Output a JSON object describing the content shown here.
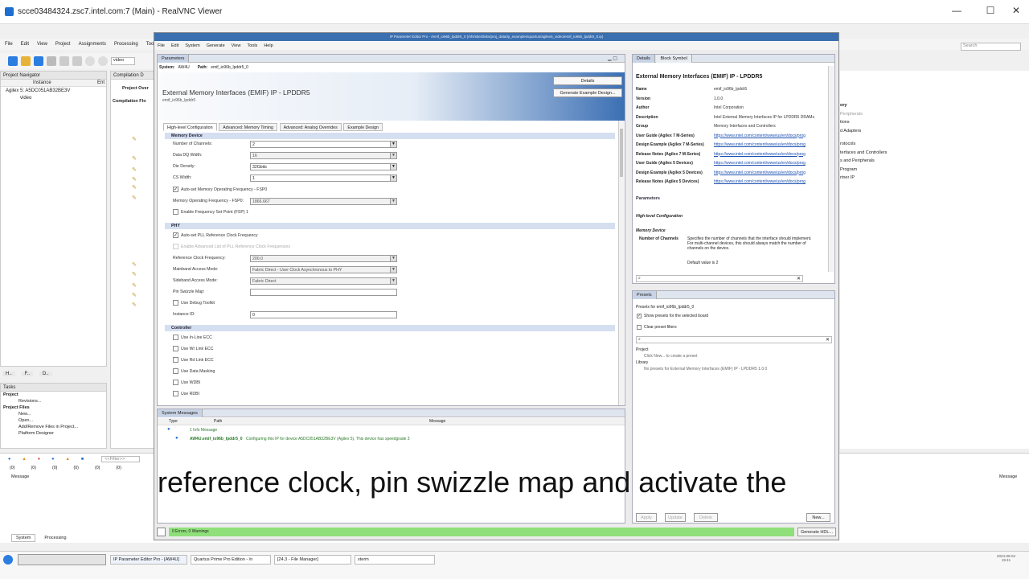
{
  "vnc": {
    "title": "scce03484324.zsc7.intel.com:7 (Main) - RealVNC Viewer",
    "min": "—",
    "max": "☐",
    "close": "✕"
  },
  "quartus": {
    "menu": [
      "File",
      "Edit",
      "View",
      "Project",
      "Assignments",
      "Processing",
      "Tool"
    ],
    "search_placeholder": "Search",
    "toolbar_field": "video",
    "project_navigator": "Project Navigator",
    "instance_header": "Instance",
    "entity_header": "Ent",
    "device_item": "Agilex 5: A5DC051AB32BE3V",
    "video_item": "video",
    "compilation_tab": "Compilation D",
    "project_over": "Project Over",
    "compilation_flow": "Compilation Flo",
    "nav_tabs": [
      "H..",
      "F..",
      "D.."
    ],
    "tasks_title": "Tasks",
    "tasks": [
      {
        "label": "Project",
        "bold": true
      },
      {
        "label": "Revisions...",
        "bold": false
      },
      {
        "label": "Project Files",
        "bold": true
      },
      {
        "label": "New...",
        "bold": false
      },
      {
        "label": "Open...",
        "bold": false
      },
      {
        "label": "Add/Remove Files in Project...",
        "bold": false
      },
      {
        "label": "Platform Designer",
        "bold": false
      }
    ],
    "msg_counts": [
      "(0)",
      "(0)",
      "(0)",
      "(0)",
      "(0)",
      "(0)"
    ],
    "filter_placeholder": "<<Filter>>",
    "message_header": "Message",
    "message_header_right": "Message",
    "bottom_tabs": [
      "System",
      "Processing"
    ],
    "right_tree": [
      "ory",
      "Peripherals",
      "tions",
      "d Adapters",
      "rotocols",
      "terfaces and Controllers",
      "s and Peripherals",
      "Program",
      "rtner IP"
    ]
  },
  "ipwin": {
    "title": "IP Parameter Editor Pro - /emif_io96b_lpddr5_0 (/nfs/site/disks/proj_data/ip_examples/quartus/agilex5_video/emif_io96b_lpddr5_0.ip)",
    "menu": [
      "File",
      "Edit",
      "System",
      "Generate",
      "View",
      "Tools",
      "Help"
    ],
    "param_tab": "Parameters",
    "system_label": "System:",
    "system_value": "AW4U",
    "path_label": "Path:",
    "path_value": "emif_io96b_lpddr5_0",
    "header_title": "External Memory Interfaces (EMIF) IP - LPDDR5",
    "header_sub": "emif_io96b_lpddr5",
    "details_btn": "Details",
    "gen_example_btn": "Generate Example Design...",
    "subtabs": [
      "High-level Configuration",
      "Advanced: Memory Timing",
      "Advanced: Analog Overrides",
      "Example Design"
    ],
    "sections": {
      "memory_device": "Memory Device",
      "phy": "PHY",
      "controller": "Controller"
    },
    "fields": {
      "num_channels": {
        "label": "Number of Channels:",
        "value": "2"
      },
      "data_width": {
        "label": "Data DQ Width:",
        "value": "16"
      },
      "die_density": {
        "label": "Die Density:",
        "value": "32Gbits"
      },
      "cs_width": {
        "label": "CS Width:",
        "value": "1"
      },
      "auto_freq": "Auto-set Memory Operating Frequency - FSP0",
      "mem_freq": {
        "label": "Memory Operating Frequency - FSP0:",
        "value": "1866.667"
      },
      "enable_fsp": "Enable Frequency Set Point (FSP) 1",
      "auto_pll": "Auto-set PLL Reference Clock Frequency",
      "enable_adv_pll": "Enable Advanced List of PLL Reference Clock Frequencies",
      "ref_clk": {
        "label": "Reference Clock Frequency:",
        "value": "200.0"
      },
      "mainband": {
        "label": "Mainband Access Mode:",
        "value": "Fabric Direct - User Clock Asynchronous to PHY"
      },
      "sideband": {
        "label": "Sideband Access Mode:",
        "value": "Fabric Direct"
      },
      "pin_swizzle": {
        "label": "Pin Swizzle Map:",
        "value": ""
      },
      "debug_toolkit": "Use Debug Toolkit",
      "instance_id": {
        "label": "Instance ID:",
        "value": "0"
      },
      "ctrl_checks": [
        "Use In-Line ECC",
        "Use Wr Link ECC",
        "Use Rd Link ECC",
        "Use Data Masking",
        "Use WDBI",
        "Use RDBI"
      ]
    },
    "details": {
      "tabs": [
        "Details",
        "Block Symbol"
      ],
      "title": "External Memory Interfaces (EMIF) IP - LPDDR5",
      "rows": [
        {
          "k": "Name",
          "v": "emif_io96b_lpddr5",
          "link": false
        },
        {
          "k": "Version",
          "v": "1.0.0",
          "link": false
        },
        {
          "k": "Author",
          "v": "Intel Corporation",
          "link": false
        },
        {
          "k": "Description",
          "v": "Intel External Memory Interfaces IP for LPDDR5 DRAMs",
          "link": false
        },
        {
          "k": "Group",
          "v": "Memory Interfaces and Controllers",
          "link": false
        },
        {
          "k": "User Guide (Agilex 7 M-Series)",
          "v": "https://www.intel.com/content/www/us/en/docs/prog",
          "link": true
        },
        {
          "k": "Design Example (Agilex 7 M-Series)",
          "v": "https://www.intel.com/content/www/us/en/docs/prog",
          "link": true
        },
        {
          "k": "Release Notes (Agilex 7 M-Series)",
          "v": "https://www.intel.com/content/www/us/en/docs/prog",
          "link": true
        },
        {
          "k": "User Guide (Agilex 5 Devices)",
          "v": "https://www.intel.com/content/www/us/en/docs/prog",
          "link": true
        },
        {
          "k": "Design Example (Agilex 5 Devices)",
          "v": "https://www.intel.com/content/www/us/en/docs/prog",
          "link": true
        },
        {
          "k": "Release Notes (Agilex 5 Devices)",
          "v": "https://www.intel.com/content/www/us/en/docs/prog",
          "link": true
        }
      ],
      "parameters": "Parameters",
      "hlc": "High-level Configuration",
      "memdev": "Memory Device",
      "numch_key": "Number of Channels",
      "numch_desc": "Specifies the number of channels that the interface should implement. For multi-channel devices, this should always match the number of channels on the device.",
      "default": "Default value is 2"
    },
    "presets": {
      "tab": "Presets",
      "for": "Presets for emif_io96b_lpddr5_0",
      "show_board": "Show presets for the selected board",
      "clear": "Clear preset filters",
      "project": "Project",
      "project_hint": "Click New... to create a preset",
      "library": "Library",
      "library_hint": "No presets for External Memory Interfaces (EMIF) IP - LPDDR5 1.0.0",
      "buttons": [
        "Apply",
        "Update",
        "Delete",
        "New..."
      ]
    },
    "sysmsg": {
      "tab": "System Messages",
      "cols": [
        "Type",
        "Path",
        "Message"
      ],
      "info_count": "1 Info Message",
      "path": "AW4U.emif_io96b_lpddr5_0",
      "message": "Configuring this IP for device A5DC051AB32BE3V (Agilex 5). This device has speedgrade 3"
    },
    "status": "0 Errors, 0 Warnings",
    "generate_hdl": "Generate HDL..."
  },
  "taskbar": {
    "items": [
      "IP Parameter Editor Pro - [AW4U]",
      "Quartus Prime Pro Edition - /n",
      "[24.3 - File Manager]",
      "xterm"
    ],
    "clock": "2024-09-04\n19:41"
  },
  "caption": "reference clock, pin swizzle map and activate the"
}
